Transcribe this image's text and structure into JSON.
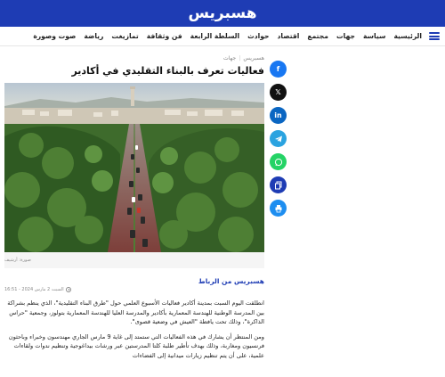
{
  "site": {
    "logo_text": "هسبريس"
  },
  "nav": {
    "items": [
      "الرئيسية",
      "سياسة",
      "جهات",
      "مجتمع",
      "اقتصاد",
      "حوادث",
      "السلطة الرابعة",
      "فن وثقافة",
      "تمازيغت",
      "رياضة",
      "صوت وصورة"
    ]
  },
  "share": {
    "icons": [
      "facebook-icon",
      "x-icon",
      "linkedin-icon",
      "telegram-icon",
      "whatsapp-icon",
      "copy-icon",
      "print-icon"
    ]
  },
  "article": {
    "breadcrumb": {
      "site": "هسبريس",
      "section": "جهات"
    },
    "title": "فعاليات تعرف بالبناء التقليدي في أكادير",
    "image_caption": "صورة: أرشيف",
    "author": "هسبريس من الرباط",
    "date": "السبت 2 مارس 2024 - 16:51",
    "paragraphs": [
      "انطلقت اليوم السبت بمدينة أكادير فعاليات الأسبوع العلمي حول \"طرق البناء التقليدية\"، الذي ينظم بشراكة بين المدرسة الوطنية للهندسة المعمارية بأكادير والمدرسة العليا للهندسة المعمارية بتولوز، وجمعية \"حراس الذاكرة\"، وذلك تحت يافطة \"العيش في وضعية قصوى\".",
      "ومن المنتظر أن يشارك في هذه الفعاليات التي ستمتد إلى غاية 9 مارس الجاري مهندسون وخبراء وباحثون فرنسيون ومغاربة، وذلك بهدف تأطير طلبة كلتا المدرستين عبر ورشات بيداغوجية وتنظيم ندوات ولقاءات علمية، على أن يتم تنظيم زيارات ميدانية إلى الفضاءات"
    ]
  },
  "colors": {
    "brand": "#1e3cb4",
    "facebook": "#1877f2",
    "x": "#111111",
    "linkedin": "#0a66c2",
    "telegram": "#2aa3e0",
    "whatsapp": "#25d366"
  }
}
